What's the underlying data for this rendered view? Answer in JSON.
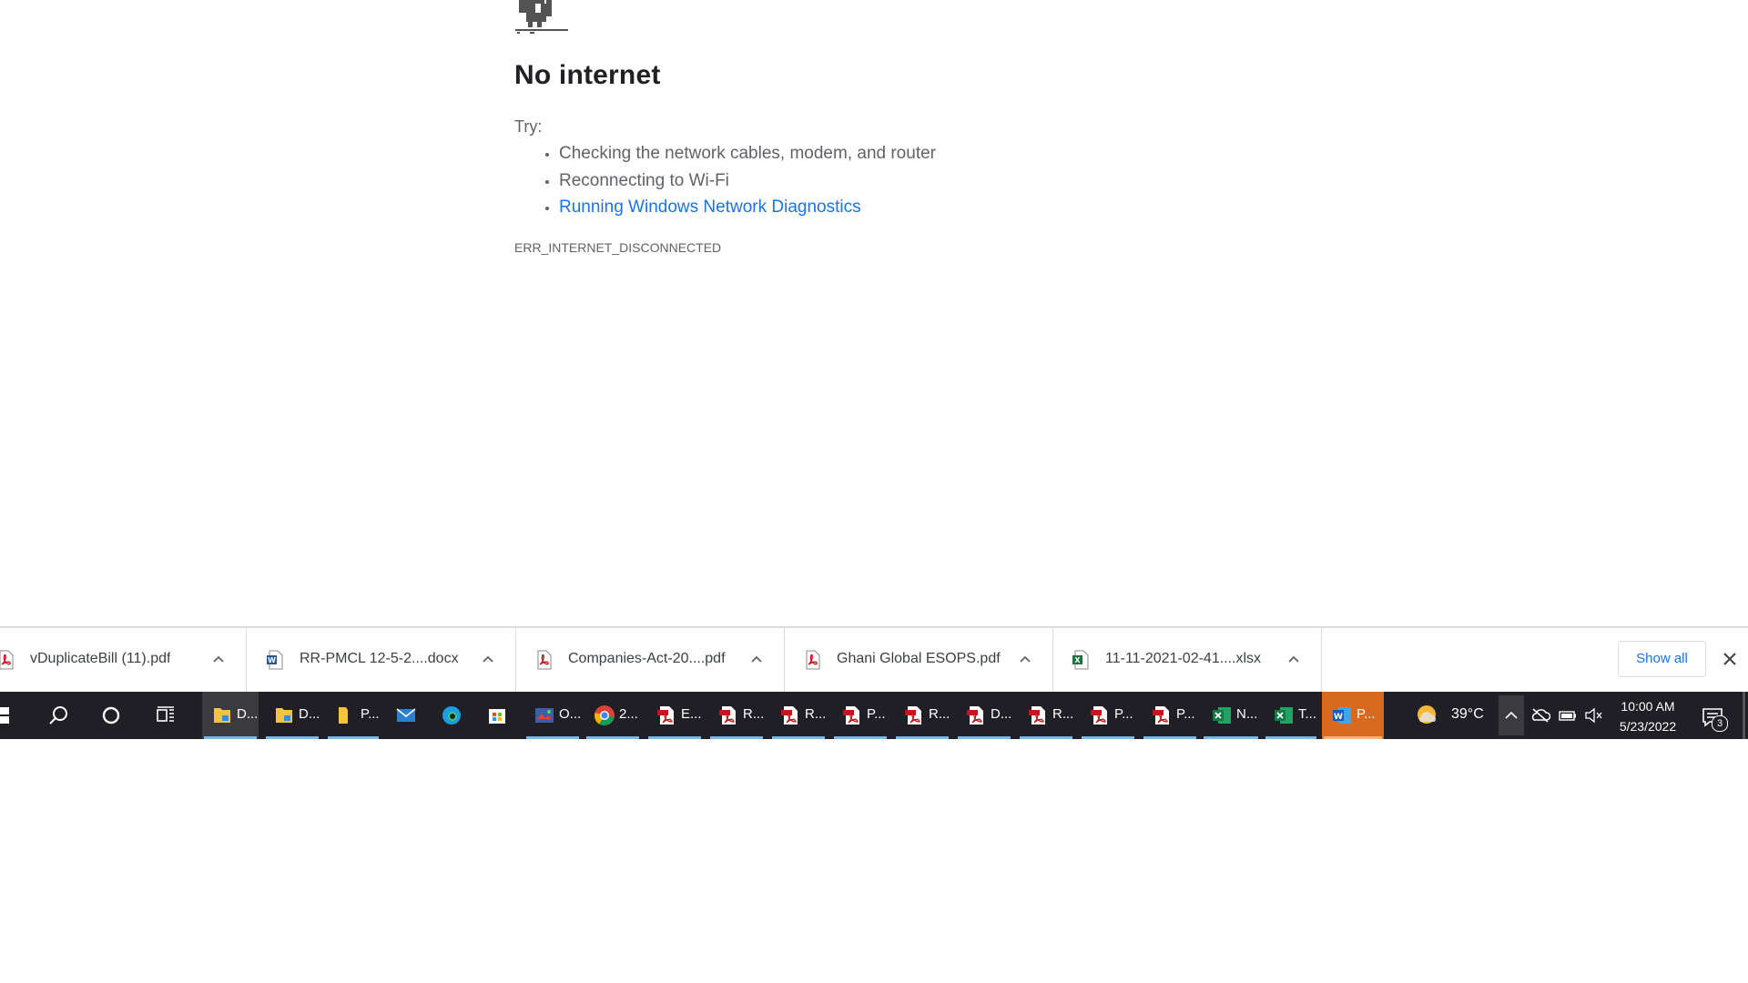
{
  "error_page": {
    "title": "No internet",
    "try_label": "Try:",
    "suggestions": [
      "Checking the network cables, modem, and router",
      "Reconnecting to Wi-Fi"
    ],
    "diagnostics_link": "Running Windows Network Diagnostics",
    "error_code": "ERR_INTERNET_DISCONNECTED"
  },
  "download_shelf": {
    "items": [
      {
        "name": "vDuplicateBill (11).pdf",
        "type": "pdf"
      },
      {
        "name": "RR-PMCL 12-5-2....docx",
        "type": "docx"
      },
      {
        "name": "Companies-Act-20....pdf",
        "type": "pdf"
      },
      {
        "name": "Ghani Global ESOPS.pdf",
        "type": "pdf"
      },
      {
        "name": "11-11-2021-02-41....xlsx",
        "type": "xlsx"
      }
    ],
    "show_all_label": "Show all"
  },
  "taskbar": {
    "apps": [
      {
        "label": "D...",
        "icon": "file-explorer-icon"
      },
      {
        "label": "D...",
        "icon": "file-explorer-icon"
      },
      {
        "label": "P...",
        "icon": "folder-icon"
      },
      {
        "label": "",
        "icon": "mail-icon"
      },
      {
        "label": "",
        "icon": "edge-icon"
      },
      {
        "label": "",
        "icon": "store-icon"
      },
      {
        "label": "O...",
        "icon": "photo-app-icon"
      },
      {
        "label": "2...",
        "icon": "chrome-icon"
      },
      {
        "label": "E...",
        "icon": "pdf-icon"
      },
      {
        "label": "R...",
        "icon": "pdf-icon"
      },
      {
        "label": "R...",
        "icon": "pdf-icon"
      },
      {
        "label": "P...",
        "icon": "pdf-icon"
      },
      {
        "label": "R...",
        "icon": "pdf-icon"
      },
      {
        "label": "D...",
        "icon": "pdf-icon"
      },
      {
        "label": "R...",
        "icon": "pdf-icon"
      },
      {
        "label": "P...",
        "icon": "pdf-icon"
      },
      {
        "label": "P...",
        "icon": "pdf-icon"
      },
      {
        "label": "N...",
        "icon": "excel-icon"
      },
      {
        "label": "T...",
        "icon": "excel-icon"
      },
      {
        "label": "P...",
        "icon": "word-icon"
      }
    ],
    "weather_temp": "39°C",
    "time": "10:00 AM",
    "date": "5/23/2022",
    "notification_count": "3"
  }
}
